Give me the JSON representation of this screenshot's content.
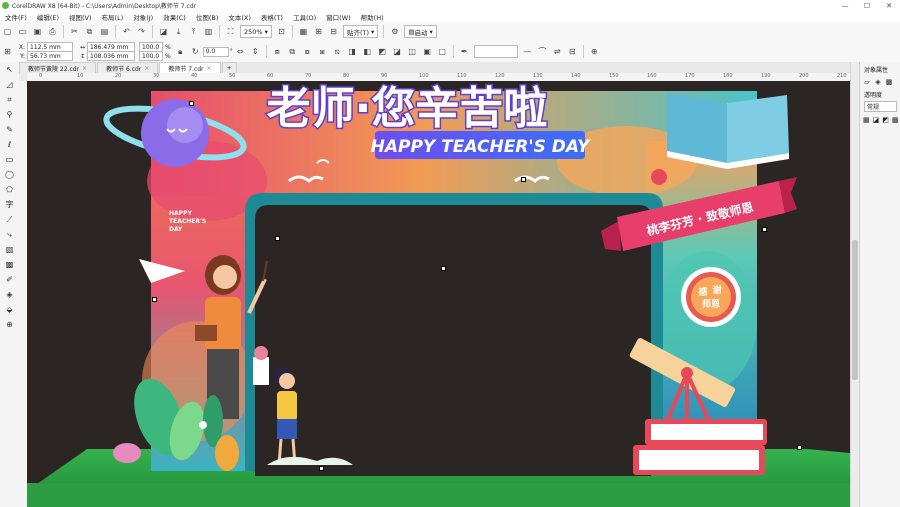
{
  "window": {
    "title": "CorelDRAW X8 (64-Bit) - C:\\Users\\Admin\\Desktop\\教师节 7.cdr",
    "minimize": "—",
    "maximize": "☐",
    "close": "✕"
  },
  "menu": [
    "文件(F)",
    "编辑(E)",
    "视图(V)",
    "布局(L)",
    "对象(J)",
    "效果(C)",
    "位图(B)",
    "文本(X)",
    "表格(T)",
    "工具(O)",
    "窗口(W)",
    "帮助(H)"
  ],
  "toolbar": {
    "zoom_value": "250%",
    "snap_label": "贴齐(T)",
    "launch_label": "启动"
  },
  "property_bar": {
    "x_label": "X:",
    "x_value": "112.5 mm",
    "y_label": "Y:",
    "y_value": "56.73 mm",
    "w_value": "186.479 mm",
    "h_value": "108.036 mm",
    "scale_w": "100.0",
    "scale_h": "100.0",
    "percent": "%",
    "rotation": "0.0",
    "degree": "°"
  },
  "tabs": [
    {
      "label": "教师节黄陵 22.cdr",
      "active": false
    },
    {
      "label": "教师节 6.cdr",
      "active": false
    },
    {
      "label": "教师节 7.cdr",
      "active": true
    }
  ],
  "ruler_ticks": [
    "0",
    "10",
    "20",
    "30",
    "40",
    "50",
    "60",
    "70",
    "80",
    "90",
    "100",
    "110",
    "120",
    "130",
    "140",
    "150",
    "160",
    "170",
    "180",
    "190",
    "200",
    "210"
  ],
  "right_panel": {
    "title": "对象属性",
    "transparency_label": "透明度",
    "mode_value": "常规"
  },
  "artwork": {
    "headline": "老师·您辛苦啦",
    "subtitle": "HAPPY TEACHER'S DAY",
    "small_text_1": "HAPPY",
    "small_text_2": "TEACHER'S",
    "small_text_3": "DAY",
    "ribbon_text": "桃李芬芳 · 致敬师恩",
    "badge_1": "谢",
    "badge_2": "师恩",
    "badge_3": "感"
  },
  "colors": {
    "canvas_bg": "#2b2524",
    "arch_teal": "#1e8a96",
    "grass": "#2fa84a",
    "ribbon": "#e83e6c"
  }
}
